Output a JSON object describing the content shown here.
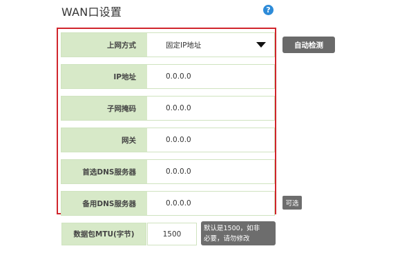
{
  "page": {
    "title": "WAN口设置",
    "help_symbol": "?"
  },
  "form": {
    "rows": [
      {
        "label": "上网方式",
        "value": "固定IP地址",
        "type": "select"
      },
      {
        "label": "IP地址",
        "value": "0.0.0.0",
        "type": "input"
      },
      {
        "label": "子网掩码",
        "value": "0.0.0.0",
        "type": "input"
      },
      {
        "label": "网关",
        "value": "0.0.0.0",
        "type": "input"
      },
      {
        "label": "首选DNS服务器",
        "value": "0.0.0.0",
        "type": "input"
      },
      {
        "label": "备用DNS服务器",
        "value": "0.0.0.0",
        "type": "input"
      }
    ],
    "auto_detect_label": "自动检测",
    "optional_tag": "可选",
    "mtu": {
      "label": "数据包MTU(字节)",
      "value": "1500",
      "hint_line1": "默认是1500，如非",
      "hint_line2": "必要，请勿修改"
    }
  },
  "colors": {
    "label_bg": "#d7e9c8",
    "highlight_border": "#d0242b",
    "button_bg": "#6a6a6a",
    "help_icon": "#2d8bd8"
  },
  "icons": {
    "help": "help-circle-icon",
    "dropdown": "caret-down-icon"
  }
}
